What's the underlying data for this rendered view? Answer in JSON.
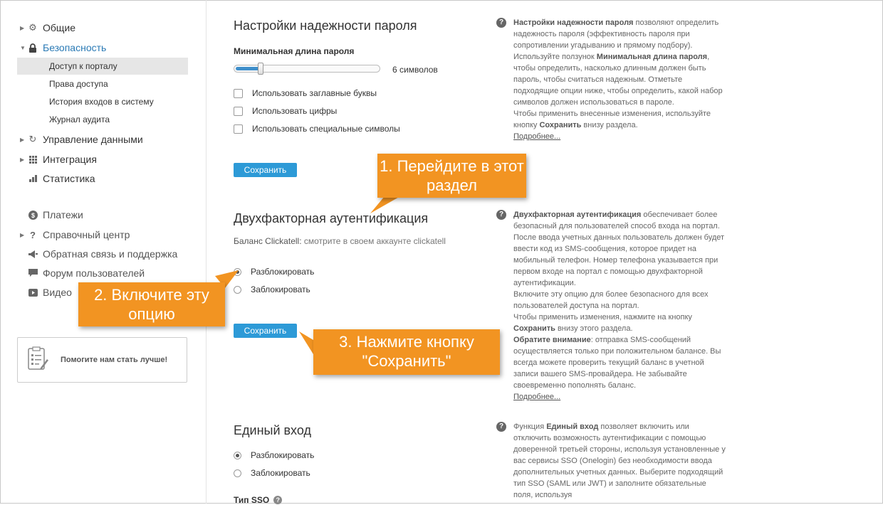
{
  "sidebar": {
    "items": [
      {
        "label": "Общие",
        "icon": "gear-icon"
      },
      {
        "label": "Безопасность",
        "icon": "lock-icon"
      },
      {
        "label": "Управление данными",
        "icon": "refresh-icon"
      },
      {
        "label": "Интеграция",
        "icon": "grid-icon"
      },
      {
        "label": "Статистика",
        "icon": "bar-chart-icon"
      },
      {
        "label": "Платежи",
        "icon": "dollar-icon"
      },
      {
        "label": "Справочный центр",
        "icon": "question-icon"
      },
      {
        "label": "Обратная связь и поддержка",
        "icon": "megaphone-icon"
      },
      {
        "label": "Форум пользователей",
        "icon": "chat-icon"
      },
      {
        "label": "Видео",
        "icon": "video-icon"
      }
    ],
    "security_sub": [
      "Доступ к порталу",
      "Права доступа",
      "История входов в систему",
      "Журнал аудита"
    ],
    "help_box": "Помогите нам стать лучше!"
  },
  "password": {
    "title": "Настройки надежности пароля",
    "min_length_label": "Минимальная длина пароля",
    "slider_value": "6 символов",
    "slider_fraction": 0.17,
    "options": [
      "Использовать заглавные буквы",
      "Использовать цифры",
      "Использовать специальные символы"
    ],
    "save": "Сохранить",
    "help_title": "Настройки надежности пароля",
    "help_1": " позволяют определить надежность пароля (эффективность пароля при сопротивлении угадыванию и прямому подбору).",
    "help_2a": "Используйте ползунок ",
    "help_2b": "Минимальная длина пароля",
    "help_2c": ", чтобы определить, насколько длинным должен быть пароль, чтобы считаться надежным. Отметьте подходящие опции ниже, чтобы определить, какой набор символов должен использоваться в пароле.",
    "help_3a": "Чтобы применить внесенные изменения, используйте кнопку ",
    "help_3b": "Сохранить",
    "help_3c": " внизу раздела.",
    "more": "Подробнее..."
  },
  "twofa": {
    "title": "Двухфакторная аутентификация",
    "balance_label": "Баланс Clickatell: ",
    "balance_link": "смотрите в своем аккаунте clickatell",
    "options": [
      "Разблокировать",
      "Заблокировать"
    ],
    "save": "Сохранить",
    "help_title": "Двухфакторная аутентификация",
    "help_1": " обеспечивает более безопасный для пользователей способ входа на портал. После ввода учетных данных пользователь должен будет ввести код из SMS-сообщения, которое придет на мобильный телефон. Номер телефона указывается при первом входе на портал с помощью двухфакторной аутентификации.",
    "help_2": "Включите эту опцию для более безопасного для всех пользователей доступа на портал.",
    "help_3a": "Чтобы применить изменения, нажмите на кнопку ",
    "help_3b": "Сохранить",
    "help_3c": " внизу этого раздела.",
    "help_4a": "Обратите внимание",
    "help_4b": ": отправка SMS-сообщений осуществляется только при положительном балансе. Вы всегда можете проверить текущий баланс в учетной записи вашего SMS-провайдера. Не забывайте своевременно пополнять баланс.",
    "more": "Подробнее..."
  },
  "sso": {
    "title": "Единый вход",
    "options": [
      "Разблокировать",
      "Заблокировать"
    ],
    "type_label": "Тип SSO",
    "help_a": "Функция ",
    "help_b": "Единый вход",
    "help_c": " позволяет включить или отключить возможность аутентификации с помощью доверенной третьей стороны, используя установленные у вас сервисы SSO (Onelogin) без необходимости ввода дополнительных учетных данных. Выберите подходящий тип SSO (SAML или JWT) и заполните обязательные поля, используя"
  },
  "callouts": {
    "c1": "1. Перейдите в этот раздел",
    "c2": "2. Включите эту опцию",
    "c3": "3. Нажмите кнопку \"Сохранить\""
  },
  "colors": {
    "accent": "#2d9ad7",
    "callout": "#f29422",
    "active_link": "#2a7ab5"
  }
}
